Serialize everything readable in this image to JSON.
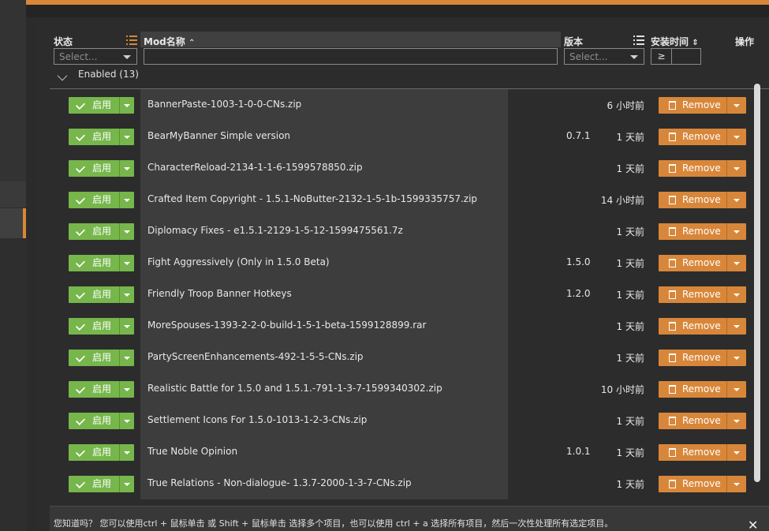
{
  "header": {
    "status_label": "状态",
    "name_label": "Mod名称",
    "name_sort_icon": "sort-asc-icon",
    "version_label": "版本",
    "install_time_label": "安装时间",
    "actions_label": "操作",
    "status_select_placeholder": "Select...",
    "version_select_placeholder": "Select...",
    "name_filter_value": "",
    "install_time_operator": "≥",
    "install_time_value": ""
  },
  "group": {
    "label": "Enabled (13)"
  },
  "rows": [
    {
      "enable_label": "启用",
      "name": "BannerPaste-1003-1-0-0-CNs.zip",
      "version": "",
      "install_time": "6 小时前",
      "remove_label": "Remove"
    },
    {
      "enable_label": "启用",
      "name": "BearMyBanner Simple version",
      "version": "0.7.1",
      "install_time": "1 天前",
      "remove_label": "Remove"
    },
    {
      "enable_label": "启用",
      "name": "CharacterReload-2134-1-1-6-1599578850.zip",
      "version": "",
      "install_time": "1 天前",
      "remove_label": "Remove"
    },
    {
      "enable_label": "启用",
      "name": "Crafted Item Copyright - 1.5.1-NoButter-2132-1-5-1b-1599335757.zip",
      "version": "",
      "install_time": "14 小时前",
      "remove_label": "Remove"
    },
    {
      "enable_label": "启用",
      "name": "Diplomacy Fixes - e1.5.1-2129-1-5-12-1599475561.7z",
      "version": "",
      "install_time": "1 天前",
      "remove_label": "Remove"
    },
    {
      "enable_label": "启用",
      "name": "Fight Aggressively (Only in 1.5.0 Beta)",
      "version": "1.5.0",
      "install_time": "1 天前",
      "remove_label": "Remove"
    },
    {
      "enable_label": "启用",
      "name": "Friendly Troop Banner Hotkeys",
      "version": "1.2.0",
      "install_time": "1 天前",
      "remove_label": "Remove"
    },
    {
      "enable_label": "启用",
      "name": "MoreSpouses-1393-2-2-0-build-1-5-1-beta-1599128899.rar",
      "version": "",
      "install_time": "1 天前",
      "remove_label": "Remove"
    },
    {
      "enable_label": "启用",
      "name": "PartyScreenEnhancements-492-1-5-5-CNs.zip",
      "version": "",
      "install_time": "1 天前",
      "remove_label": "Remove"
    },
    {
      "enable_label": "启用",
      "name": "Realistic Battle for 1.5.0 and 1.5.1.-791-1-3-7-1599340302.zip",
      "version": "",
      "install_time": "10 小时前",
      "remove_label": "Remove"
    },
    {
      "enable_label": "启用",
      "name": "Settlement Icons For 1.5.0-1013-1-2-3-CNs.zip",
      "version": "",
      "install_time": "1 天前",
      "remove_label": "Remove"
    },
    {
      "enable_label": "启用",
      "name": "True Noble Opinion",
      "version": "1.0.1",
      "install_time": "1 天前",
      "remove_label": "Remove"
    },
    {
      "enable_label": "启用",
      "name": "True Relations - Non-dialogue- 1.3.7-2000-1-3-7-CNs.zip",
      "version": "",
      "install_time": "1 天前",
      "remove_label": "Remove"
    }
  ],
  "tip": {
    "text": "您知道吗？ 您可以使用ctrl + 鼠标单击 或 Shift + 鼠标单击 选择多个项目，也可以使用 ctrl + a 选择所有项目，然后一次性处理所有选定项目。",
    "close_glyph": "✕"
  },
  "colors": {
    "accent_orange": "#d8873a",
    "enable_green": "#76b64b",
    "background": "#2b2b2b"
  }
}
